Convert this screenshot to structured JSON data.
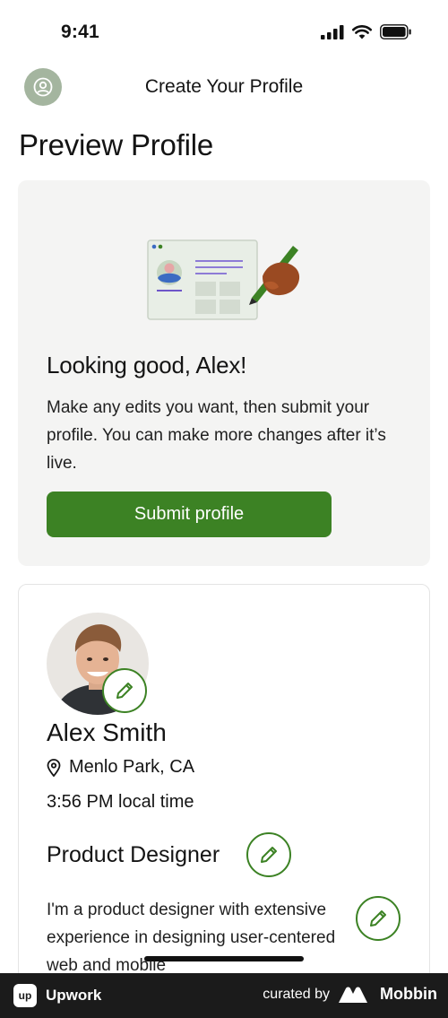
{
  "status_bar": {
    "time": "9:41"
  },
  "header": {
    "title": "Create Your Profile",
    "avatar_icon": "user-circle-icon"
  },
  "page": {
    "title": "Preview Profile"
  },
  "intro_card": {
    "heading": "Looking good, Alex!",
    "body": "Make any edits you want, then submit your profile. You can make more changes after it’s live.",
    "submit_label": "Submit profile"
  },
  "profile": {
    "name": "Alex Smith",
    "location": "Menlo Park, CA",
    "local_time": "3:56 PM local time",
    "title": "Product Designer",
    "bio": "I'm a product designer with extensive experience in designing user-centered web and mobile"
  },
  "footer": {
    "brand": "Upwork",
    "brand_badge": "up",
    "curated_by": "curated by",
    "curator": "Mobbin"
  },
  "colors": {
    "accent_green": "#3c8224",
    "avatar_bg": "#a4b59f",
    "card_bg": "#f4f4f3",
    "footer_bg": "#1b1b1b"
  }
}
